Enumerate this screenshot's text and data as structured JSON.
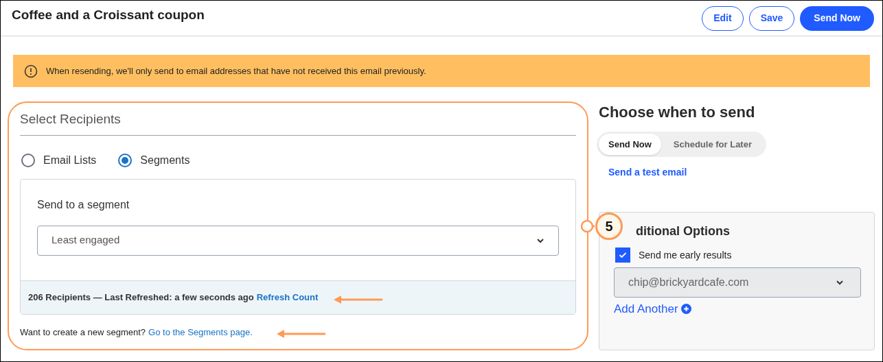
{
  "header": {
    "title": "Coffee and a Croissant coupon",
    "buttons": [
      {
        "label": "Edit",
        "kind": "outline"
      },
      {
        "label": "Save",
        "kind": "outline"
      },
      {
        "label": "Send Now",
        "kind": "primary"
      }
    ]
  },
  "banner": {
    "text": "When resending, we'll only send to email addresses that have not received this email previously."
  },
  "recipients": {
    "title": "Select Recipients",
    "options": [
      {
        "label": "Email Lists",
        "selected": false
      },
      {
        "label": "Segments",
        "selected": true
      }
    ],
    "segment_label": "Send to a segment",
    "segment_value": "Least engaged",
    "count_text": "206 Recipients — Last Refreshed: a few seconds ago",
    "refresh_link": "Refresh Count",
    "create_text": "Want to create a new segment?",
    "create_link": "Go to the Segments page."
  },
  "schedule": {
    "title": "Choose when to send",
    "tabs": [
      {
        "label": "Send Now",
        "selected": true
      },
      {
        "label": "Schedule for Later",
        "selected": false
      }
    ],
    "test_link": "Send a test email"
  },
  "options": {
    "title": "ditional Options",
    "early_results": {
      "label": "Send me early results",
      "checked": true
    },
    "email_value": "chip@brickyardcafe.com",
    "add_link": "Add Another"
  },
  "callout": {
    "number": "5"
  }
}
